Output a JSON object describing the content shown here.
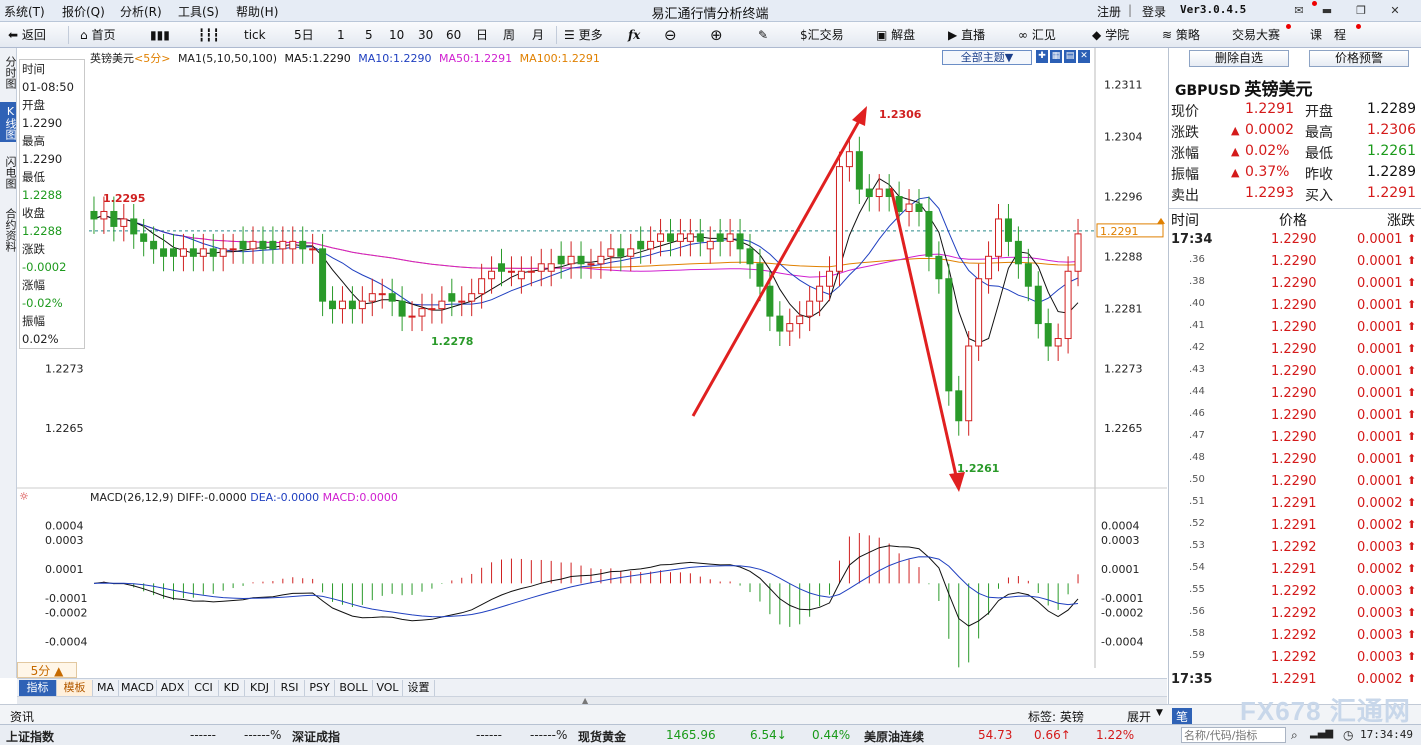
{
  "app": {
    "title": "易汇通行情分析终端",
    "version": "Ver3.0.4.5"
  },
  "menus": [
    "系统(T)",
    "报价(Q)",
    "分析(R)",
    "工具(S)",
    "帮助(H)"
  ],
  "account": {
    "register": "注册",
    "login": "登录"
  },
  "toolbar": {
    "back": "返回",
    "home": "首页",
    "tick": "tick",
    "periods": [
      "5日",
      "1",
      "5",
      "10",
      "30",
      "60",
      "日",
      "周",
      "月"
    ],
    "more": "更多",
    "trade": "汇交易",
    "analysis": "解盘",
    "live": "直播",
    "huijian": "汇见",
    "academy": "学院",
    "strategy": "策略",
    "contest": "交易大赛",
    "course": "课　程"
  },
  "left_tabs": [
    {
      "label": "分时图",
      "active": false
    },
    {
      "label": "K线图",
      "active": true
    },
    {
      "label": "闪电图",
      "active": false
    },
    {
      "label": "合约资料",
      "active": false
    }
  ],
  "chart_header": {
    "name": "英镑美元",
    "period": "<5分>",
    "ma_label": "MA1(5,10,50,100)",
    "ma5": "MA5:1.2290",
    "ma10": "MA10:1.2290",
    "ma50": "MA50:1.2291",
    "ma100": "MA100:1.2291",
    "topic": "全部主题▼",
    "colors": {
      "ma5": "#111111",
      "ma10": "#2040c0",
      "ma50": "#d020d0",
      "ma100": "#e08000"
    }
  },
  "info_box": {
    "time_label": "时间",
    "time": "01-08:50",
    "open_label": "开盘",
    "open": "1.2290",
    "high_label": "最高",
    "high": "1.2290",
    "low_label": "最低",
    "low": "1.2288",
    "close_label": "收盘",
    "close": "1.2288",
    "chg_label": "涨跌",
    "chg": "-0.0002",
    "pct_label": "涨幅",
    "pct": "-0.02%",
    "amp_label": "振幅",
    "amp": "0.02%"
  },
  "chart_data": {
    "type": "candlestick",
    "price_axis": {
      "ticks": [
        "1.2311",
        "1.2304",
        "1.2296",
        "1.2288",
        "1.2281",
        "1.2273",
        "1.2265"
      ],
      "min": 1.2257,
      "max": 1.2314
    },
    "left_axis_ticks": [
      "1.2273",
      "1.2265"
    ],
    "current_price": "1.2291",
    "annotations": {
      "high": "1.2306",
      "low": "1.2261",
      "local_high": "1.2295",
      "local_low": "1.2278"
    },
    "candles_close": [
      1.2293,
      1.2294,
      1.2292,
      1.2293,
      1.2291,
      1.229,
      1.2289,
      1.2288,
      1.2288,
      1.2289,
      1.2288,
      1.2289,
      1.2288,
      1.2289,
      1.2289,
      1.2289,
      1.229,
      1.2289,
      1.2289,
      1.229,
      1.229,
      1.2289,
      1.2289,
      1.2282,
      1.2281,
      1.2282,
      1.2281,
      1.2282,
      1.2283,
      1.2283,
      1.2282,
      1.228,
      1.228,
      1.2281,
      1.2281,
      1.2282,
      1.2282,
      1.2282,
      1.2283,
      1.2285,
      1.2286,
      1.2286,
      1.2286,
      1.2286,
      1.2286,
      1.2287,
      1.2287,
      1.2287,
      1.2288,
      1.2287,
      1.2287,
      1.2288,
      1.2289,
      1.2288,
      1.2289,
      1.2289,
      1.229,
      1.2291,
      1.229,
      1.2291,
      1.2291,
      1.229,
      1.229,
      1.229,
      1.2291,
      1.2289,
      1.2287,
      1.2284,
      1.228,
      1.2278,
      1.2279,
      1.228,
      1.2282,
      1.2284,
      1.2286,
      1.23,
      1.2302,
      1.2297,
      1.2296,
      1.2297,
      1.2296,
      1.2294,
      1.2295,
      1.2294,
      1.2288,
      1.2285,
      1.227,
      1.2266,
      1.2276,
      1.2285,
      1.2288,
      1.2293,
      1.229,
      1.2287,
      1.2284,
      1.2279,
      1.2276,
      1.2277,
      1.2286,
      1.2291
    ],
    "candles_open": [
      1.2294,
      1.2293,
      1.2294,
      1.2292,
      1.2293,
      1.2291,
      1.229,
      1.2289,
      1.2289,
      1.2288,
      1.2289,
      1.2288,
      1.2289,
      1.2288,
      1.2289,
      1.229,
      1.2289,
      1.229,
      1.229,
      1.2289,
      1.2289,
      1.229,
      1.2289,
      1.2289,
      1.2282,
      1.2281,
      1.2282,
      1.2281,
      1.2282,
      1.2283,
      1.2283,
      1.2282,
      1.228,
      1.228,
      1.2281,
      1.2281,
      1.2283,
      1.2282,
      1.2282,
      1.2283,
      1.2285,
      1.2287,
      1.2286,
      1.2285,
      1.2286,
      1.2286,
      1.2286,
      1.2288,
      1.2287,
      1.2288,
      1.2287,
      1.2287,
      1.2288,
      1.2289,
      1.2288,
      1.229,
      1.2289,
      1.229,
      1.2291,
      1.229,
      1.229,
      1.2291,
      1.2289,
      1.2291,
      1.229,
      1.2291,
      1.2289,
      1.2287,
      1.2284,
      1.228,
      1.2278,
      1.2279,
      1.228,
      1.2282,
      1.2284,
      1.2286,
      1.23,
      1.2302,
      1.2297,
      1.2296,
      1.2297,
      1.2296,
      1.2294,
      1.2295,
      1.2294,
      1.2288,
      1.2285,
      1.227,
      1.2266,
      1.2276,
      1.2285,
      1.2288,
      1.2293,
      1.229,
      1.2287,
      1.2284,
      1.2279,
      1.2276,
      1.2277,
      1.2286
    ],
    "macd_axis": {
      "ticks": [
        "0.0004",
        "0.0003",
        "0.0001",
        "-0.0001",
        "-0.0002",
        "-0.0004"
      ],
      "min": -0.0005,
      "max": 0.00045
    },
    "macd_header": {
      "label": "MACD(26,12,9)",
      "diff": "DIFF:-0.0000",
      "dea": "DEA:-0.0000",
      "macd": "MACD:0.0000"
    }
  },
  "period_label": "5分 ▲",
  "bottom_tabs": [
    "指标",
    "模板",
    "MA",
    "MACD",
    "ADX",
    "CCI",
    "KD",
    "KDJ",
    "RSI",
    "PSY",
    "BOLL",
    "VOL",
    "设置"
  ],
  "right_panel": {
    "remove_btn": "删除自选",
    "alert_btn": "价格预警",
    "symbol": "GBPUSD",
    "symbol_cn": "英镑美元",
    "quotes": [
      {
        "l1": "现价",
        "v1": "1.2291",
        "c1": "red",
        "l2": "开盘",
        "v2": "1.2289",
        "c2": "blk"
      },
      {
        "l1": "涨跌",
        "v1": "0.0002",
        "c1": "red",
        "l2": "最高",
        "v2": "1.2306",
        "c2": "red",
        "arrow": true
      },
      {
        "l1": "涨幅",
        "v1": "0.02%",
        "c1": "red",
        "l2": "最低",
        "v2": "1.2261",
        "c2": "green",
        "arrow": true
      },
      {
        "l1": "振幅",
        "v1": "0.37%",
        "c1": "red",
        "l2": "昨收",
        "v2": "1.2289",
        "c2": "blk",
        "arrow": true
      },
      {
        "l1": "卖出",
        "v1": "1.2293",
        "c1": "red",
        "l2": "买入",
        "v2": "1.2291",
        "c2": "red"
      }
    ],
    "tick_head": {
      "time": "时间",
      "price": "价格",
      "chg": "涨跌"
    },
    "ticks": [
      {
        "t": "17:34",
        "p": "1.2290",
        "c": "0.0001"
      },
      {
        "t": ".36",
        "p": "1.2290",
        "c": "0.0001"
      },
      {
        "t": ".38",
        "p": "1.2290",
        "c": "0.0001"
      },
      {
        "t": ".40",
        "p": "1.2290",
        "c": "0.0001"
      },
      {
        "t": ".41",
        "p": "1.2290",
        "c": "0.0001"
      },
      {
        "t": ".42",
        "p": "1.2290",
        "c": "0.0001"
      },
      {
        "t": ".43",
        "p": "1.2290",
        "c": "0.0001"
      },
      {
        "t": ".44",
        "p": "1.2290",
        "c": "0.0001"
      },
      {
        "t": ".46",
        "p": "1.2290",
        "c": "0.0001"
      },
      {
        "t": ".47",
        "p": "1.2290",
        "c": "0.0001"
      },
      {
        "t": ".48",
        "p": "1.2290",
        "c": "0.0001"
      },
      {
        "t": ".50",
        "p": "1.2290",
        "c": "0.0001"
      },
      {
        "t": ".51",
        "p": "1.2291",
        "c": "0.0002"
      },
      {
        "t": ".52",
        "p": "1.2291",
        "c": "0.0002"
      },
      {
        "t": ".53",
        "p": "1.2292",
        "c": "0.0003"
      },
      {
        "t": ".54",
        "p": "1.2291",
        "c": "0.0002"
      },
      {
        "t": ".55",
        "p": "1.2292",
        "c": "0.0003"
      },
      {
        "t": ".56",
        "p": "1.2292",
        "c": "0.0003"
      },
      {
        "t": ".58",
        "p": "1.2292",
        "c": "0.0003"
      },
      {
        "t": ".59",
        "p": "1.2292",
        "c": "0.0003"
      },
      {
        "t": "17:35",
        "p": "1.2291",
        "c": "0.0002"
      }
    ]
  },
  "newsbar": {
    "news": "资讯",
    "tag": "标签: 英镑",
    "expand": "展开",
    "pen": "笔"
  },
  "ticker": [
    {
      "name": "上证指数",
      "val": "------",
      "pct": "------%"
    },
    {
      "name": "深证成指",
      "val": "------",
      "pct": "------%"
    },
    {
      "name": "现货黄金",
      "val": "1465.96",
      "chg": "6.54↓",
      "pct": "0.44%"
    },
    {
      "name": "美原油连续",
      "val": "54.73",
      "chg": "0.66↑",
      "pct": "1.22%"
    }
  ],
  "search_placeholder": "名称/代码/指标",
  "clock": "17:34:49",
  "watermark": "FX678 汇通网"
}
